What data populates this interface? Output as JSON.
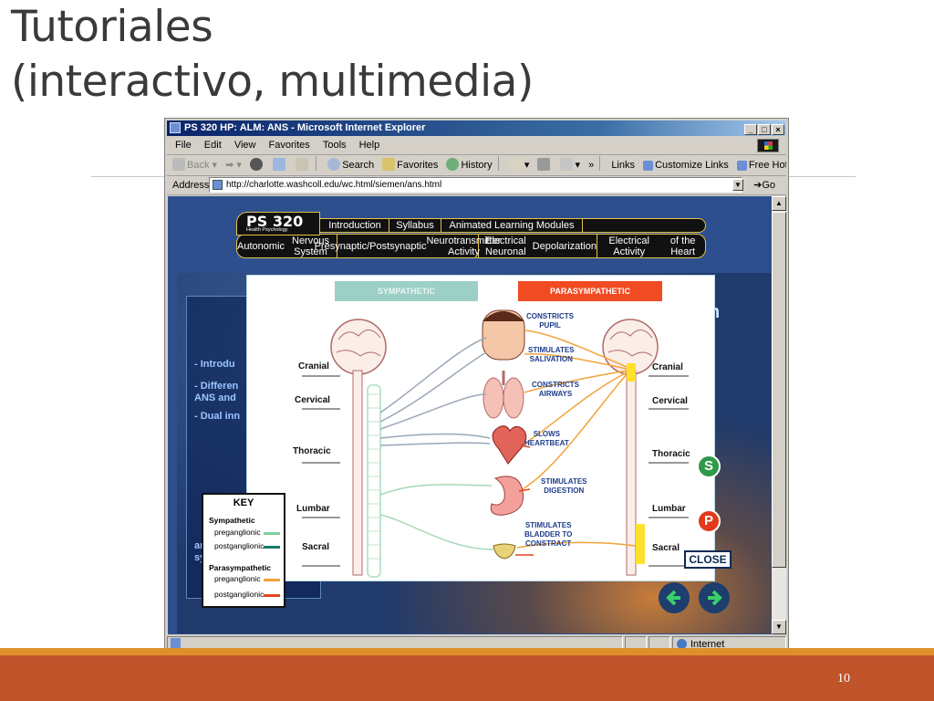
{
  "slide": {
    "title_line1": "Tutoriales",
    "title_line2": "(interactivo, multimedia)",
    "page_number": "10"
  },
  "browser": {
    "window_title": "PS 320 HP: ALM: ANS - Microsoft Internet Explorer",
    "menu": [
      "File",
      "Edit",
      "View",
      "Favorites",
      "Tools",
      "Help"
    ],
    "toolbar": {
      "back": "Back",
      "search": "Search",
      "favorites": "Favorites",
      "history": "History",
      "links": "Links",
      "customize_links": "Customize Links",
      "free_hotmail": "Free Hotmail"
    },
    "address_label": "Address",
    "url": "http://charlotte.washcoll.edu/wc.html/siemen/ans.html",
    "go_label": "Go",
    "status_zone": "Internet"
  },
  "page": {
    "logo_title": "PS 320",
    "logo_subtitle": "Health Psychology",
    "nav_top": [
      "Introduction",
      "Syllabus",
      "Animated Learning Modules"
    ],
    "nav_modules": [
      {
        "line1": "Autonomic",
        "line2": "Nervous System"
      },
      {
        "line1": "Presynaptic/Postsynaptic",
        "line2": "Neurotransmitter Activity"
      },
      {
        "line1": "Electrical Neuronal",
        "line2": "Depolarization"
      },
      {
        "line1": "Electrical Activity",
        "line2": "of the Heart"
      }
    ],
    "heading_fragment": "n",
    "sidebar_lines": [
      "- Introdu",
      "- Differen",
      "ANS and",
      "- Dual inn",
      "and para",
      "systems"
    ],
    "diagram": {
      "tab_sympathetic": "SYMPATHETIC",
      "tab_parasympathetic": "PARASYMPATHETIC",
      "left_regions": [
        "Cranial",
        "Cervical",
        "Thoracic",
        "Lumbar",
        "Sacral"
      ],
      "right_regions": [
        "Cranial",
        "Cervical",
        "Thoracic",
        "Lumbar",
        "Sacral"
      ],
      "effects": [
        {
          "line1": "CONSTRICTS",
          "line2": "PUPIL"
        },
        {
          "line1": "STIMULATES",
          "line2": "SALIVATION"
        },
        {
          "line1": "CONSTRICTS",
          "line2": "AIRWAYS"
        },
        {
          "line1": "SLOWS",
          "line2": "HEARTBEAT"
        },
        {
          "line1": "STIMULATES",
          "line2": "DIGESTION"
        },
        {
          "line1": "STIMULATES",
          "line2": "BLADDER TO",
          "line3": "CONSTRACT"
        }
      ]
    },
    "key": {
      "title": "KEY",
      "sympathetic": "Sympathetic",
      "parasympathetic": "Parasympathetic",
      "preganglionic": "preganglionic",
      "postganglionic": "postganglionic"
    },
    "close_label": "CLOSE",
    "s_button": "S",
    "p_button": "P"
  },
  "colors": {
    "sympathetic_pre": "#7fcfa0",
    "sympathetic_post": "#1a7a6a",
    "parasympathetic_pre": "#f2a33a",
    "parasympathetic_post": "#e2461f"
  }
}
